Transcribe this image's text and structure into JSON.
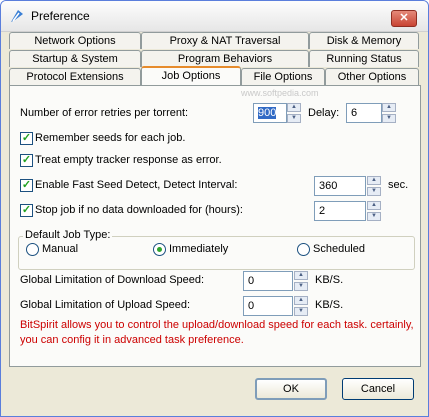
{
  "window": {
    "title": "Preference",
    "close_glyph": "✕"
  },
  "tabs": {
    "row1": [
      "Network Options",
      "Proxy & NAT Traversal",
      "Disk & Memory"
    ],
    "row2": [
      "Startup & System",
      "Program Behaviors",
      "Running Status"
    ],
    "row3": [
      "Protocol Extensions",
      "Job Options",
      "File Options",
      "Other Options"
    ],
    "active": "Job Options"
  },
  "watermark": "www.softpedia.com",
  "job": {
    "retries_label": "Number of error retries per torrent:",
    "retries_value": "900",
    "delay_label": "Delay:",
    "delay_value": "6",
    "remember_seeds_label": "Remember seeds for each job.",
    "treat_empty_label": "Treat empty tracker response as error.",
    "fast_seed_label": "Enable Fast Seed Detect, Detect Interval:",
    "fast_seed_value": "360",
    "fast_seed_unit": "sec.",
    "stop_job_label": "Stop job if no data downloaded for (hours):",
    "stop_job_value": "2"
  },
  "job_type": {
    "title": "Default Job Type:",
    "options": [
      "Manual",
      "Immediately",
      "Scheduled"
    ],
    "selected": "Immediately"
  },
  "limits": {
    "download_label": "Global Limitation of Download Speed:",
    "download_value": "0",
    "upload_label": "Global Limitation of Upload Speed:",
    "upload_value": "0",
    "unit": "KB/S."
  },
  "info_text": "BitSpirit allows you to control the upload/download speed for each task. certainly, you can config it in advanced task preference.",
  "buttons": {
    "ok": "OK",
    "cancel": "Cancel"
  },
  "colors": {
    "info": "#cc0000",
    "active_tab_accent": "#e68b2c",
    "selection": "#316ac5"
  }
}
